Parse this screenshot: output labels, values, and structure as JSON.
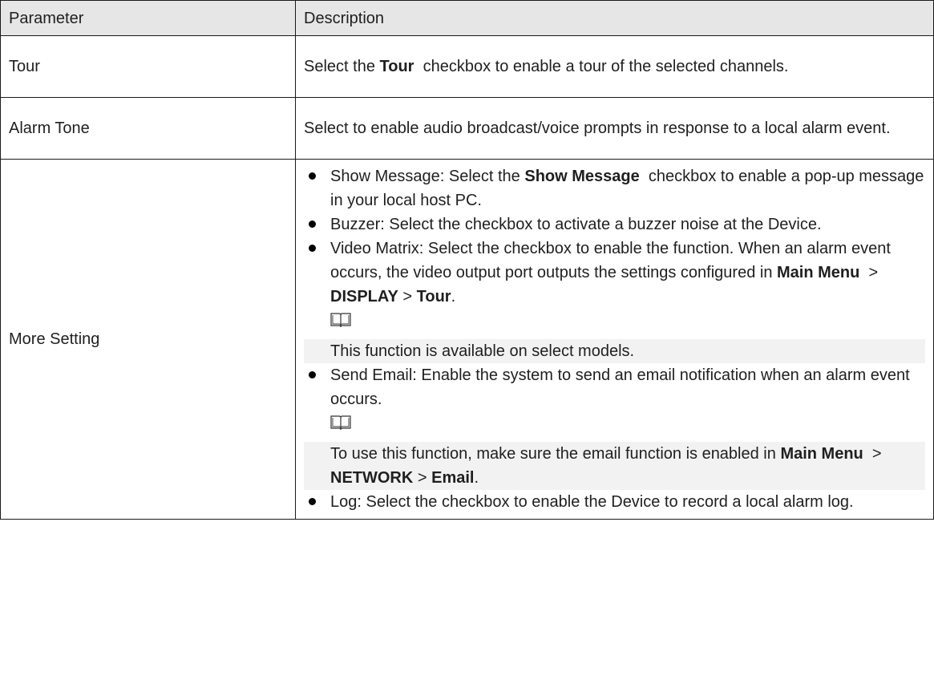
{
  "table": {
    "headers": [
      "Parameter",
      "Description"
    ],
    "rows": {
      "tour": {
        "param": "Tour",
        "desc": {
          "pre": "Select the ",
          "bold": "Tour",
          "post": "  checkbox to enable a tour of the selected channels."
        }
      },
      "alarm_tone": {
        "param": "Alarm Tone",
        "desc": "Select to enable audio broadcast/voice prompts in response to a local alarm event."
      },
      "more_setting": {
        "param": "More Setting",
        "items": {
          "show_message": {
            "pre": "Show Message: Select the ",
            "bold": "Show Message",
            "post": "  checkbox to enable a pop-up message in your local host PC."
          },
          "buzzer": {
            "text": "Buzzer: Select the checkbox to activate a buzzer noise at the Device."
          },
          "video_matrix": {
            "pre": "Video Matrix: Select the checkbox to enable the function. When an alarm event occurs, the video output port outputs the settings configured in ",
            "bold1": "Main Menu",
            "sep1": "  > ",
            "bold2": "DISPLAY",
            "sep2": " > ",
            "bold3": "Tour",
            "end": ".",
            "note_icon": "book-note-icon",
            "note": "This function is available on select models."
          },
          "send_email": {
            "text": "Send Email: Enable the system to send an email notification when an alarm event occurs.",
            "note_icon": "book-note-icon",
            "note_pre": "To use this function, make sure the email function is enabled in ",
            "bold1": "Main Menu",
            "sep1": "  > ",
            "bold2": "NETWORK",
            "sep2": " > ",
            "bold3": "Email",
            "end": "."
          },
          "log": {
            "text": "Log: Select the checkbox to enable the Device to record a local alarm log."
          }
        }
      }
    }
  },
  "colors": {
    "header_bg": "#e6e6e6",
    "note_bg": "#f2f2f2",
    "border": "#1a1a1a"
  }
}
